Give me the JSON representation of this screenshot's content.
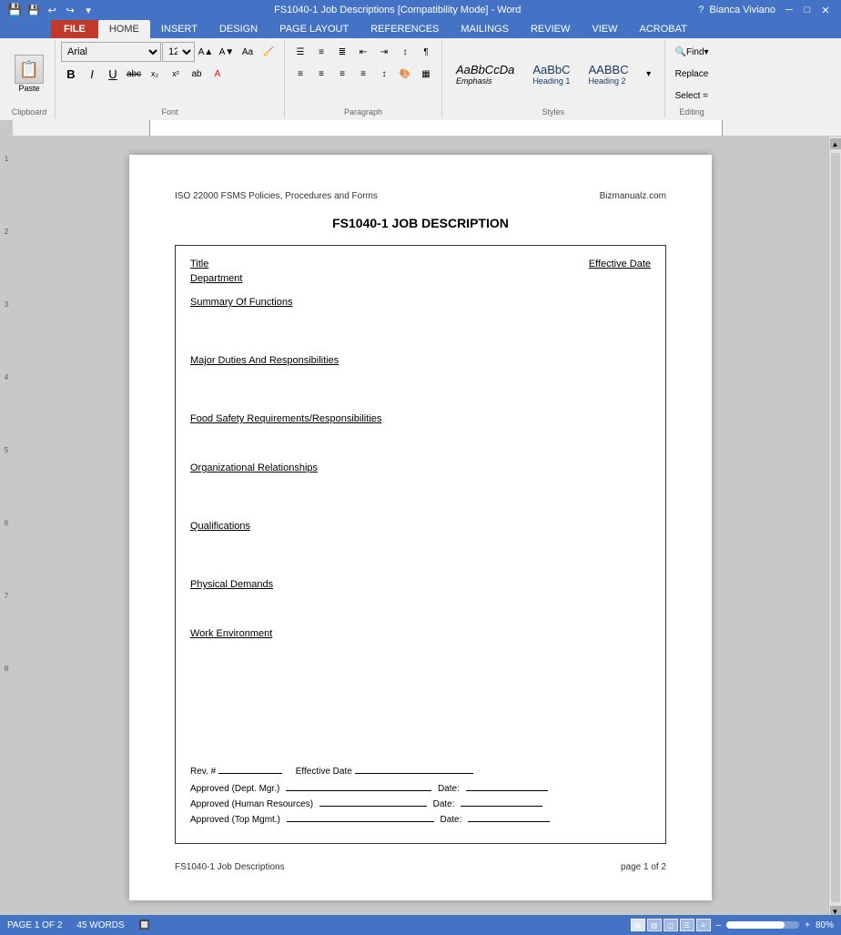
{
  "titleBar": {
    "title": "FS1040-1 Job Descriptions [Compatibility Mode] - Word",
    "helpBtn": "?",
    "minBtn": "─",
    "maxBtn": "□",
    "closeBtn": "✕",
    "userLabel": "Bianca Viviano",
    "acrobatBtn": "?"
  },
  "ribbon": {
    "fileLabel": "FILE",
    "tabs": [
      "HOME",
      "INSERT",
      "DESIGN",
      "PAGE LAYOUT",
      "REFERENCES",
      "MAILINGS",
      "REVIEW",
      "VIEW",
      "ACROBAT"
    ],
    "activeTab": "HOME",
    "clipboard": {
      "label": "Clipboard",
      "pasteLabel": "Paste"
    },
    "font": {
      "label": "Font",
      "fontName": "Arial",
      "fontSize": "12",
      "boldBtn": "B",
      "italicBtn": "I",
      "underlineBtn": "U",
      "strikeBtn": "abc",
      "subscriptBtn": "x₂",
      "superscriptBtn": "x²"
    },
    "paragraph": {
      "label": "Paragraph"
    },
    "styles": {
      "label": "Styles",
      "items": [
        "Emphasis",
        "Heading 1",
        "Heading 2"
      ],
      "previews": [
        "AaBbCcDa",
        "AaBbC",
        "AABBC"
      ]
    },
    "editing": {
      "label": "Editing",
      "findLabel": "Find",
      "replaceLabel": "Replace",
      "selectLabel": "Select ="
    }
  },
  "document": {
    "headerLeft": "ISO 22000 FSMS Policies, Procedures and Forms",
    "headerRight": "Bizmanualz.com",
    "title": "FS1040-1 JOB DESCRIPTION",
    "fields": {
      "titleLabel": "Title",
      "effectiveDateLabel": "Effective Date",
      "departmentLabel": "Department"
    },
    "sections": [
      {
        "heading": "Summary Of Functions"
      },
      {
        "heading": "Major Duties And Responsibilities"
      },
      {
        "heading": "Food Safety Requirements/Responsibilities"
      },
      {
        "heading": "Organizational Relationships"
      },
      {
        "heading": "Qualifications"
      },
      {
        "heading": "Physical Demands"
      },
      {
        "heading": "Work Environment"
      }
    ],
    "approval": {
      "revLabel": "Rev. #",
      "revLine": "________",
      "effectiveDateLabel": "Effective Date",
      "effectiveDateLine": "________________",
      "rows": [
        {
          "label": "Approved (Dept. Mgr.)",
          "line": "_______________________________",
          "dateLabel": "Date:",
          "dateLine": "____________"
        },
        {
          "label": "Approved (Human Resources)",
          "line": "_______________________",
          "dateLabel": "Date:",
          "dateLine": "____________"
        },
        {
          "label": "Approved (Top Mgmt.)",
          "line": "_______________________________",
          "dateLabel": "Date:",
          "dateLine": "____________"
        }
      ]
    },
    "footerLeft": "FS1040-1 Job Descriptions",
    "footerRight": "page 1 of 2"
  },
  "statusBar": {
    "pageInfo": "PAGE 1 OF 2",
    "wordCount": "45 WORDS",
    "trackChanges": "🔲",
    "zoomLevel": "80%"
  }
}
